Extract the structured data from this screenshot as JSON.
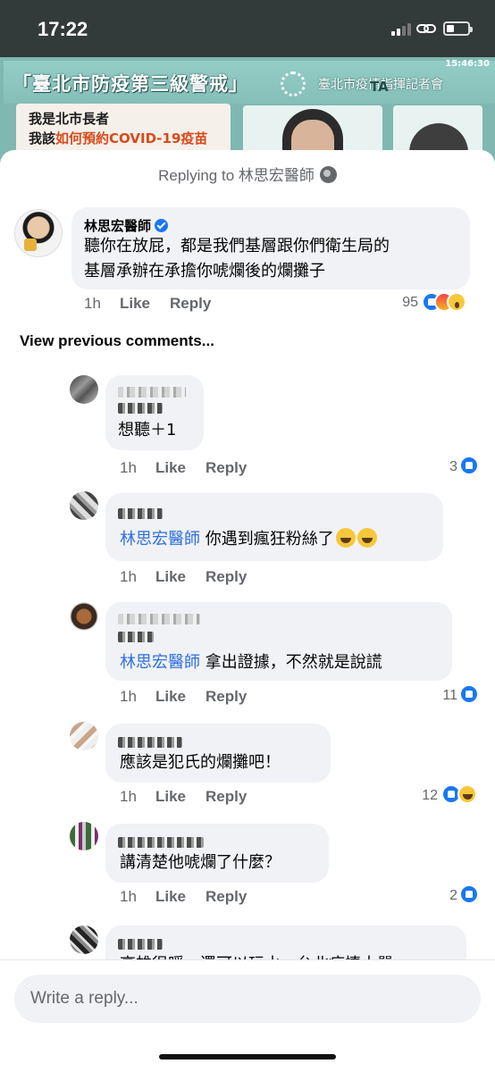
{
  "status_bar": {
    "time": "17:22"
  },
  "video": {
    "title": "「臺北市防疫第三級警戒」",
    "subtitle": "臺北市疫情指揮記者會",
    "timestamp": "15:46:30",
    "card_line1": "我是北市長者",
    "card_line2_a": "我該",
    "card_line2_b": "如何預約COVID-19疫苗",
    "tag": "TA"
  },
  "sheet": {
    "replying_to": "Replying to 林思宏醫師",
    "view_previous": "View previous comments...",
    "reply_placeholder": "Write a reply..."
  },
  "main_comment": {
    "author": "林思宏醫師",
    "text_line1": "聽你在放屁，都是我們基層跟你們衛生局的",
    "text_line2": "基層承辦在承擔你唬爛後的爛攤子",
    "time": "1h",
    "like": "Like",
    "reply": "Reply",
    "reaction_count": "95"
  },
  "replies": [
    {
      "text": "想聽＋1",
      "time": "1h",
      "like": "Like",
      "reply": "Reply",
      "count": "3"
    },
    {
      "mention": "林思宏醫師",
      "text": " 你遇到瘋狂粉絲了",
      "time": "1h",
      "like": "Like",
      "reply": "Reply",
      "count": ""
    },
    {
      "mention": "林思宏醫師",
      "text": " 拿出證據，不然就是說謊",
      "time": "1h",
      "like": "Like",
      "reply": "Reply",
      "count": "11"
    },
    {
      "text": "應該是犯氏的爛攤吧！",
      "time": "1h",
      "like": "Like",
      "reply": "Reply",
      "count": "12"
    },
    {
      "text": "講清楚他唬爛了什麼？",
      "time": "1h",
      "like": "Like",
      "reply": "Reply",
      "count": "2"
    },
    {
      "text": "高雄很暖，還可以玩水。台北疫情太嚴"
    }
  ],
  "colors": {
    "facebook_blue": "#1877f2",
    "mention_blue": "#2f6fdf",
    "bubble_bg": "#f0f2f5",
    "muted": "#65676b"
  }
}
